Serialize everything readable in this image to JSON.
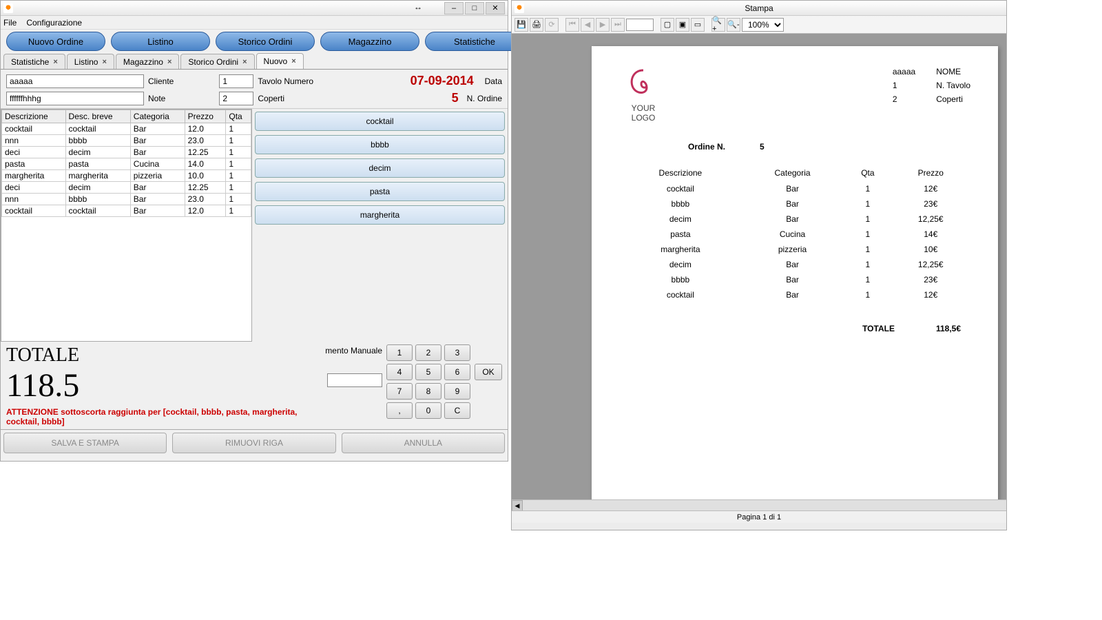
{
  "main": {
    "menus": {
      "file": "File",
      "config": "Configurazione"
    },
    "toolbar": {
      "nuovo_ordine": "Nuovo Ordine",
      "listino": "Listino",
      "storico": "Storico Ordini",
      "magazzino": "Magazzino",
      "statistiche": "Statistiche"
    },
    "tabs": [
      {
        "label": "Statistiche"
      },
      {
        "label": "Listino"
      },
      {
        "label": "Magazzino"
      },
      {
        "label": "Storico Ordini"
      },
      {
        "label": "Nuovo"
      }
    ],
    "form": {
      "cliente_value": "aaaaa",
      "cliente_label": "Cliente",
      "tavolo_value": "1",
      "tavolo_label": "Tavolo Numero",
      "data_value": "07-09-2014",
      "data_label": "Data",
      "note_value": "ffffffhhhg",
      "note_label": "Note",
      "coperti_value": "2",
      "coperti_label": "Coperti",
      "nordine_value": "5",
      "nordine_label": "N. Ordine"
    },
    "table": {
      "headers": {
        "desc": "Descrizione",
        "breve": "Desc. breve",
        "cat": "Categoria",
        "prezzo": "Prezzo",
        "qta": "Qta"
      },
      "rows": [
        {
          "desc": "cocktail",
          "breve": "cocktail",
          "cat": "Bar",
          "prezzo": "12.0",
          "qta": "1"
        },
        {
          "desc": "nnn",
          "breve": "bbbb",
          "cat": "Bar",
          "prezzo": "23.0",
          "qta": "1"
        },
        {
          "desc": "deci",
          "breve": "decim",
          "cat": "Bar",
          "prezzo": "12.25",
          "qta": "1"
        },
        {
          "desc": "pasta",
          "breve": "pasta",
          "cat": "Cucina",
          "prezzo": "14.0",
          "qta": "1"
        },
        {
          "desc": "margherita",
          "breve": "margherita",
          "cat": "pizzeria",
          "prezzo": "10.0",
          "qta": "1"
        },
        {
          "desc": "deci",
          "breve": "decim",
          "cat": "Bar",
          "prezzo": "12.25",
          "qta": "1"
        },
        {
          "desc": "nnn",
          "breve": "bbbb",
          "cat": "Bar",
          "prezzo": "23.0",
          "qta": "1"
        },
        {
          "desc": "cocktail",
          "breve": "cocktail",
          "cat": "Bar",
          "prezzo": "12.0",
          "qta": "1"
        }
      ]
    },
    "item_buttons": [
      "cocktail",
      "bbbb",
      "decim",
      "pasta",
      "margherita"
    ],
    "total_label": "TOTALE",
    "total_value": "118.5",
    "warning": "ATTENZIONE sottoscorta raggiunta per [cocktail, bbbb, pasta, margherita, cocktail, bbbb]",
    "keypad_label": "mento Manuale",
    "keypad": {
      "k1": "1",
      "k2": "2",
      "k3": "3",
      "k4": "4",
      "k5": "5",
      "k6": "6",
      "k7": "7",
      "k8": "8",
      "k9": "9",
      "k0": "0",
      "comma": ",",
      "c": "C",
      "ok": "OK"
    },
    "actions": {
      "salva": "SALVA E STAMPA",
      "rimuovi": "RIMUOVI RIGA",
      "annulla": "ANNULLA"
    }
  },
  "print": {
    "title": "Stampa",
    "zoom": "100%",
    "status": "Pagina 1 di 1",
    "logo_text": "YOUR LOGO",
    "head": {
      "nome_val": "aaaaa",
      "nome_lbl": "NOME",
      "tavolo_val": "1",
      "tavolo_lbl": "N. Tavolo",
      "coperti_val": "2",
      "coperti_lbl": "Coperti"
    },
    "ordine_lbl": "Ordine N.",
    "ordine_val": "5",
    "headers": {
      "desc": "Descrizione",
      "cat": "Categoria",
      "qta": "Qta",
      "prezzo": "Prezzo"
    },
    "rows": [
      {
        "desc": "cocktail",
        "cat": "Bar",
        "qta": "1",
        "prezzo": "12€"
      },
      {
        "desc": "bbbb",
        "cat": "Bar",
        "qta": "1",
        "prezzo": "23€"
      },
      {
        "desc": "decim",
        "cat": "Bar",
        "qta": "1",
        "prezzo": "12,25€"
      },
      {
        "desc": "pasta",
        "cat": "Cucina",
        "qta": "1",
        "prezzo": "14€"
      },
      {
        "desc": "margherita",
        "cat": "pizzeria",
        "qta": "1",
        "prezzo": "10€"
      },
      {
        "desc": "decim",
        "cat": "Bar",
        "qta": "1",
        "prezzo": "12,25€"
      },
      {
        "desc": "bbbb",
        "cat": "Bar",
        "qta": "1",
        "prezzo": "23€"
      },
      {
        "desc": "cocktail",
        "cat": "Bar",
        "qta": "1",
        "prezzo": "12€"
      }
    ],
    "total_lbl": "TOTALE",
    "total_val": "118,5€"
  }
}
